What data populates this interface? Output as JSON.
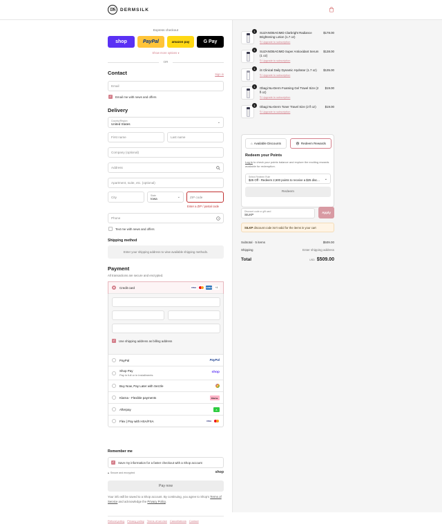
{
  "header": {
    "brand": "DERMSILK",
    "brand_mark": "DS",
    "cart_icon": "shopping-bag-icon"
  },
  "express": {
    "title": "Express checkout",
    "buttons": [
      {
        "label": "shop",
        "color": "#5a31f4"
      },
      {
        "label": "PayPal",
        "color": "#ffc439"
      },
      {
        "label": "amazon pay",
        "color": "#ffd814"
      },
      {
        "label": "G Pay",
        "color": "#000000"
      }
    ],
    "more": "Show more options",
    "or": "OR"
  },
  "contact": {
    "title": "Contact",
    "signin": "Sign in",
    "email_placeholder": "Email",
    "news_label": "Email me with news and offers",
    "news_checked": true
  },
  "delivery": {
    "title": "Delivery",
    "country_label": "Country/Region",
    "country_value": "United States",
    "first_name": "First name",
    "last_name": "Last name",
    "company": "Company (optional)",
    "address": "Address",
    "apartment": "Apartment, suite, etc. (optional)",
    "city": "City",
    "state_label": "State",
    "state_value": "Iowa",
    "zip": "ZIP code",
    "zip_error": "Enter a ZIP / postal code",
    "phone": "Phone",
    "text_label": "Text me with news and offers"
  },
  "shipping": {
    "title": "Shipping method",
    "note": "Enter your shipping address to view available shipping methods."
  },
  "payment": {
    "title": "Payment",
    "subtitle": "All transactions are secure and encrypted.",
    "credit_card": "Credit card",
    "card_more": "+4",
    "billing_label": "Use shipping address as billing address",
    "options": [
      {
        "label": "PayPal",
        "sub": "",
        "badge": "PayPal"
      },
      {
        "label": "Shop Pay",
        "sub": "Pay in full or in installments",
        "badge": "shop"
      },
      {
        "label": "Buy Now, Pay Later with Sezzle",
        "sub": "",
        "badge": "S"
      },
      {
        "label": "Klarna - Flexible payments",
        "sub": "",
        "badge": "Klarna."
      },
      {
        "label": "Afterpay",
        "sub": "",
        "badge": "A"
      },
      {
        "label": "Flex | Pay with HSA/FSA",
        "sub": "",
        "badge": "VISA"
      }
    ]
  },
  "remember": {
    "title": "Remember me",
    "save_label": "Save my information for a faster checkout with a Shop account",
    "secure": "Secure and encrypted",
    "shop": "shop"
  },
  "pay_now": "Pay now",
  "fine": {
    "pre": "Your info will be saved to a Shop account. By continuing, you agree to Shop's",
    "terms": "Terms of Service",
    "mid": "and acknowledge the",
    "privacy": "Privacy Policy",
    "end": "."
  },
  "footer_links": [
    "Refund policy",
    "Privacy policy",
    "Terms of service",
    "Cancellations",
    "Contact"
  ],
  "cart": {
    "items": [
      {
        "qty": "1",
        "name": "SUZANOBAGIMD Clarbright Radiance Brightening Lotion (1.7 oz)",
        "upgrade": "Upgrade to subscription",
        "price": "$178.00"
      },
      {
        "qty": "1",
        "name": "SUZANOBAGIMD Super Antioxidant Serum (1 oz)",
        "upgrade": "Upgrade to subscription",
        "price": "$138.00"
      },
      {
        "qty": "1",
        "name": "iS Clinical Daily Dynamic Hydrator (1.7 oz)",
        "upgrade": "Upgrade to subscription",
        "price": "$135.00"
      },
      {
        "qty": "1",
        "name": "Obagi Nu-Derm Foaming Gel Travel Size (2 fl oz)",
        "upgrade": "Upgrade to subscription",
        "price": "$19.00"
      },
      {
        "qty": "1",
        "name": "Obagi Nu-Derm Toner Travel Size (2 fl oz)",
        "upgrade": "Upgrade to subscription",
        "price": "$19.00"
      }
    ]
  },
  "rewards": {
    "tab_discounts": "Available Discounts",
    "tab_redeem": "Redeem Rewards",
    "title": "Redeem your Points",
    "login": "Log in",
    "desc": "to check your points balance and explore the exciting rewards available for redemption.",
    "select_label": "Select Redeem Rule",
    "select_value": "$25 Off - Redeem 2,500 points to receive a $25 disc...",
    "button": "Redeem"
  },
  "discount": {
    "label": "Discount code or gift card",
    "value": "SILKP",
    "apply": "Apply",
    "warning_code": "SILKP",
    "warning_text": "discount code isn't valid for the items in your cart"
  },
  "summary": {
    "subtotal_label": "Subtotal · 5 items",
    "subtotal_value": "$509.00",
    "shipping_label": "Shipping",
    "shipping_value": "Enter shipping address",
    "total_label": "Total",
    "currency": "USD",
    "total_value": "$509.00"
  }
}
